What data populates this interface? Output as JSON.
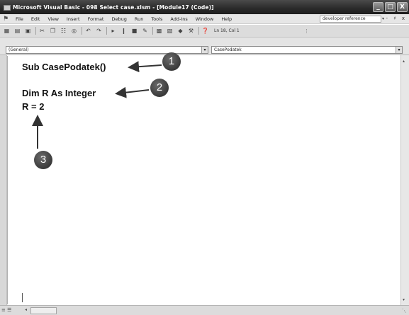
{
  "window": {
    "title": "Microsoft Visual Basic - 098 Select case.xlsm - [Module17 (Code)]",
    "controls": [
      "_",
      "□",
      "X"
    ]
  },
  "menubar": {
    "items": [
      "File",
      "Edit",
      "View",
      "Insert",
      "Format",
      "Debug",
      "Run",
      "Tools",
      "Add-Ins",
      "Window",
      "Help"
    ],
    "help_search": "developer reference",
    "mdi_controls": "- ♯ x"
  },
  "toolbar": {
    "position": "Ln 18, Col 1"
  },
  "combos": {
    "object": "(General)",
    "procedure": "CasePodatek"
  },
  "code": {
    "lines": [
      "Sub CasePodatek()",
      "Dim R As Integer",
      "R = 2"
    ]
  },
  "callouts": [
    "1",
    "2",
    "3"
  ]
}
